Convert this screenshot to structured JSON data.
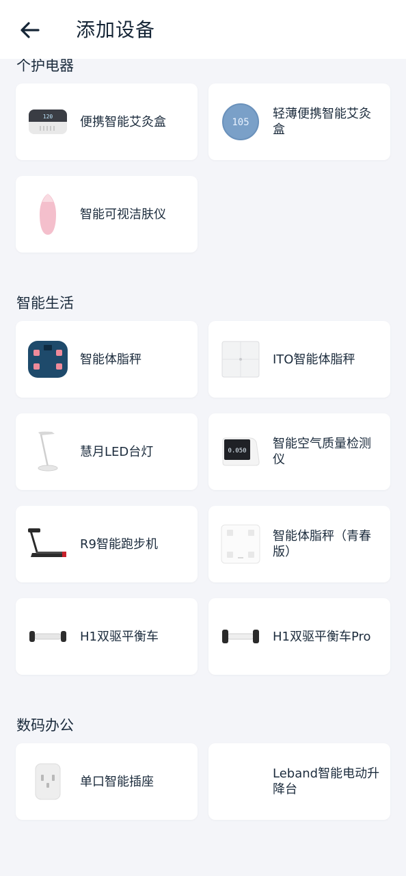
{
  "header": {
    "title": "添加设备"
  },
  "sections": [
    {
      "title": "个护电器",
      "items": [
        "便携智能艾灸盒",
        "轻薄便携智能艾灸盒",
        "智能可视洁肤仪"
      ]
    },
    {
      "title": "智能生活",
      "items": [
        "智能体脂秤",
        "ITO智能体脂秤",
        "慧月LED台灯",
        "智能空气质量检测仪",
        "R9智能跑步机",
        "智能体脂秤（青春版）",
        "H1双驱平衡车",
        "H1双驱平衡车Pro"
      ]
    },
    {
      "title": "数码办公",
      "items": [
        "单口智能插座",
        "Leband智能电动升降台"
      ]
    }
  ],
  "icons": {
    "back": "arrow-left-icon",
    "thumbs": [
      "moxibustion-box",
      "thin-moxibustion-box",
      "face-cleanser",
      "body-fat-scale-blue",
      "ito-body-fat-scale",
      "led-desk-lamp",
      "air-quality-monitor",
      "treadmill",
      "youth-body-fat-scale",
      "balance-scooter",
      "balance-scooter-pro",
      "smart-socket",
      "standing-desk"
    ]
  },
  "device_screens": {
    "moxibustion": "120",
    "thin_moxibustion": "105",
    "air_monitor": "0.050"
  },
  "colors": {
    "background": "#f4f5f9",
    "card": "#ffffff",
    "text": "#1b2b3c",
    "scale_blue": "#1e4a6b",
    "pink": "#f4bfcc",
    "moxi_blue": "#7aa0c8"
  }
}
